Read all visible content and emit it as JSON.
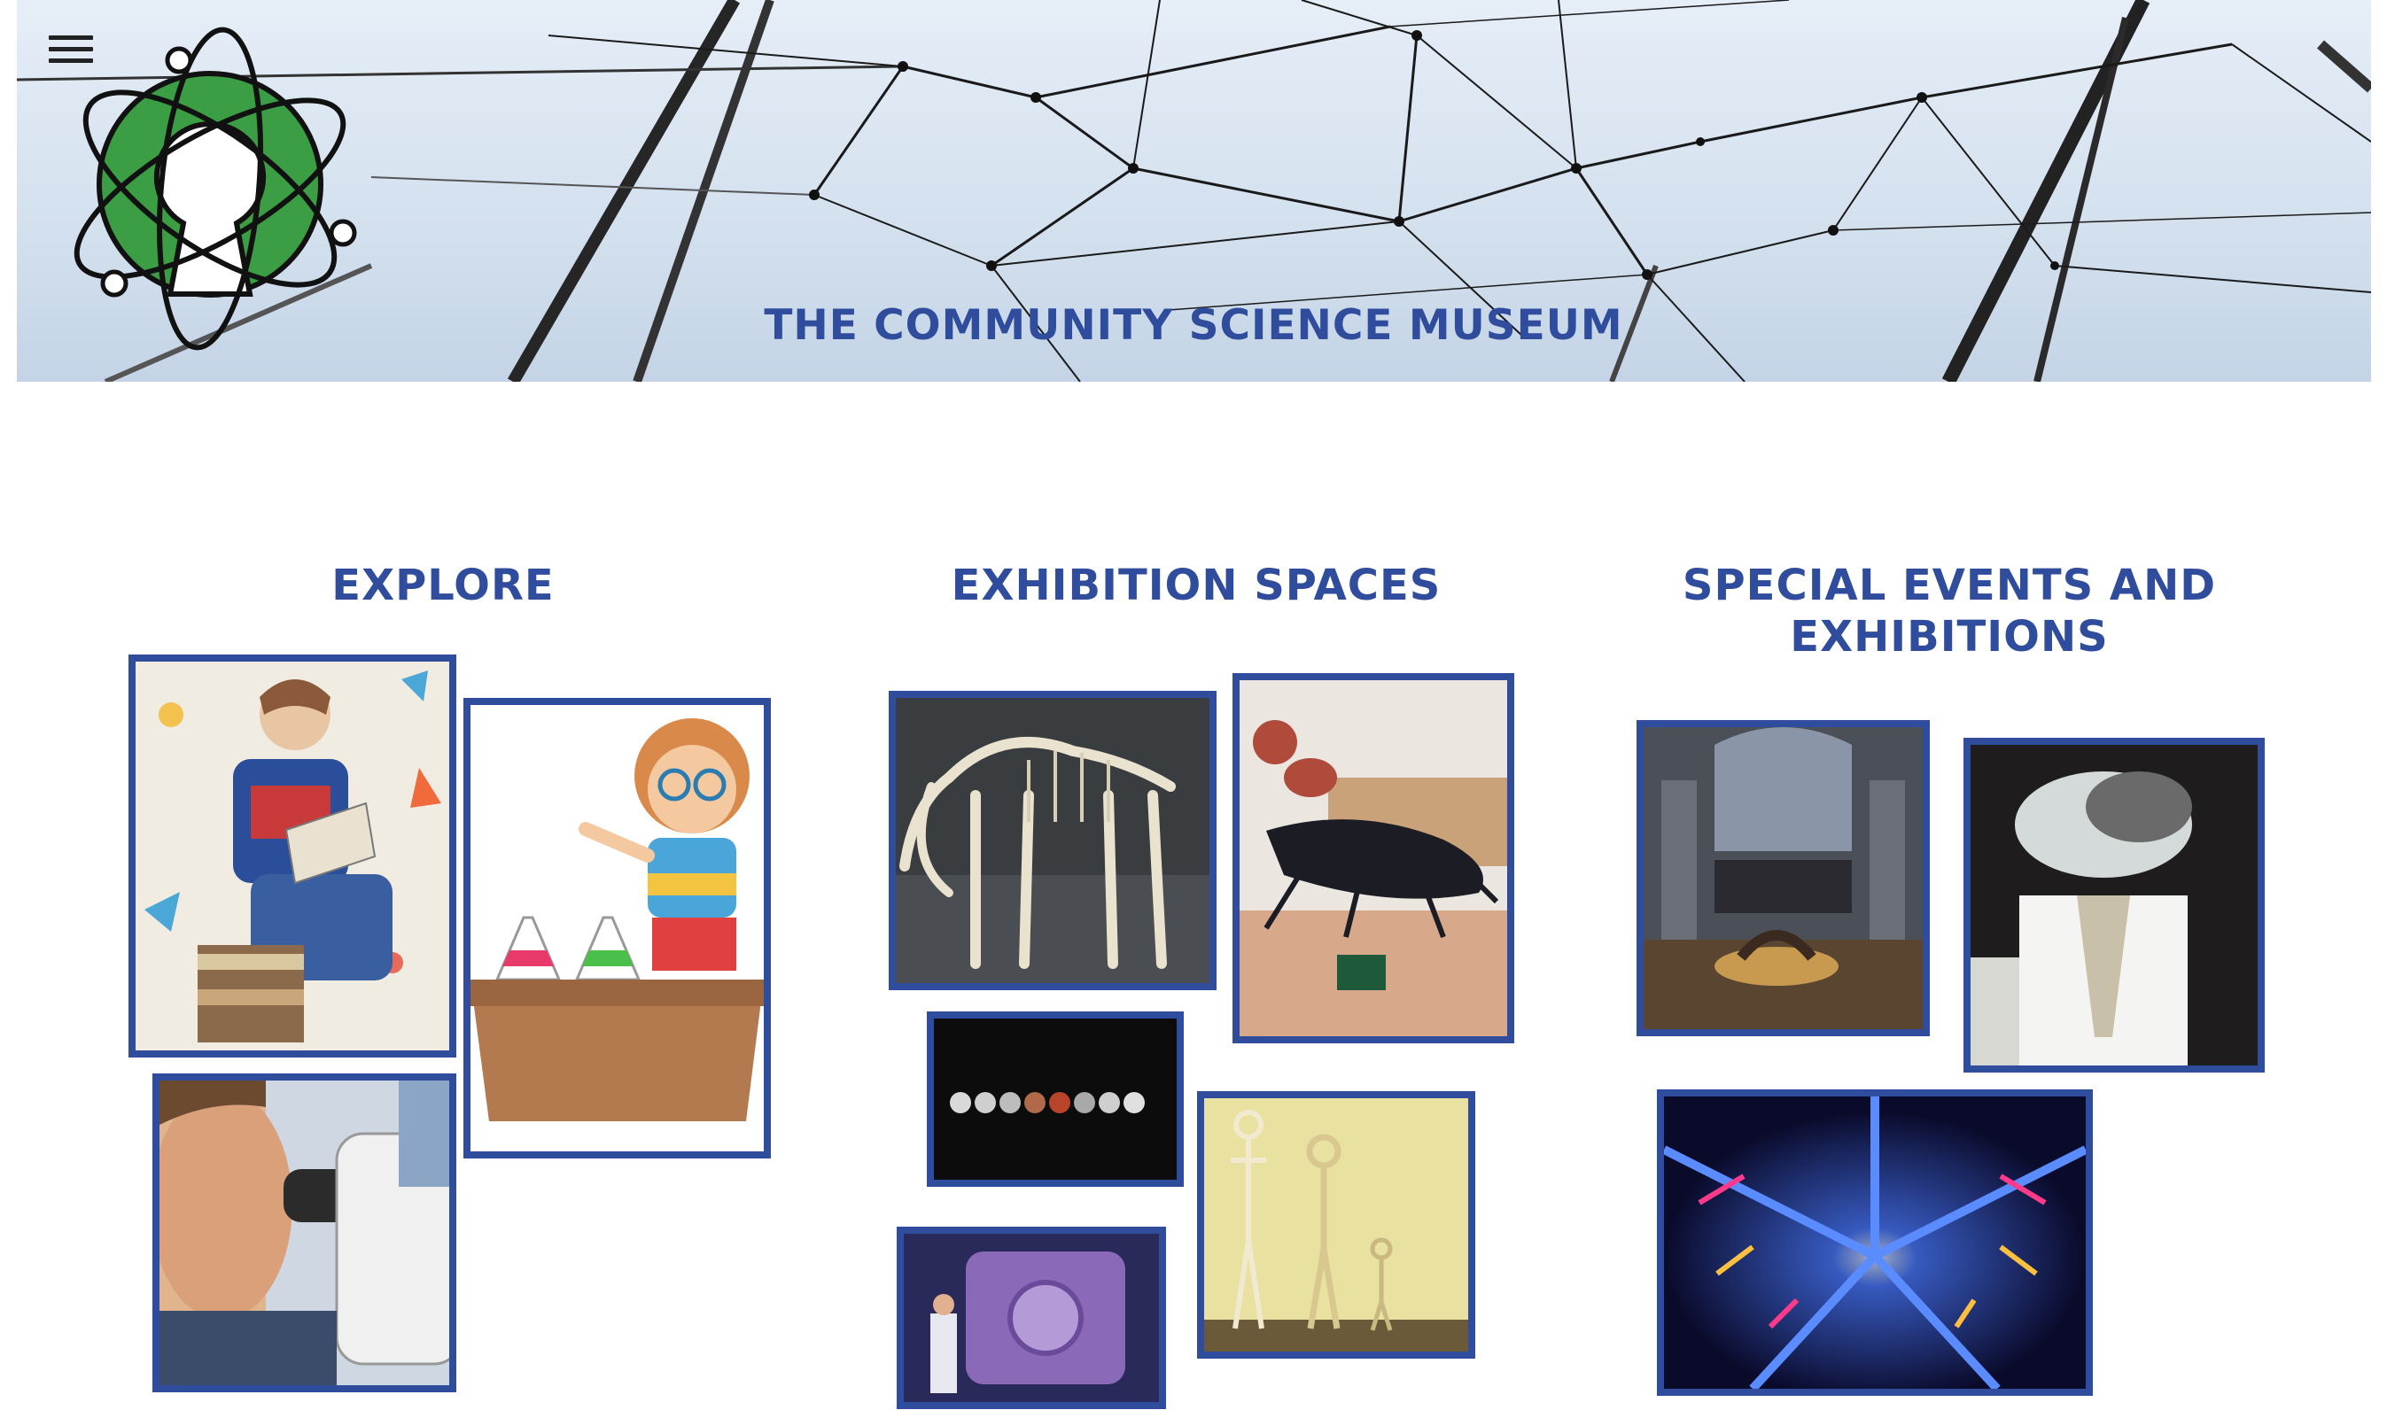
{
  "header": {
    "title": "THE COMMUNITY SCIENCE MUSEUM",
    "menu_icon": "hamburger-menu-icon",
    "logo_icon": "atom-keyhole-logo"
  },
  "sections": [
    {
      "title": "EXPLORE"
    },
    {
      "title": "EXHIBITION SPACES"
    },
    {
      "title": "SPECIAL EVENTS AND EXHIBITIONS"
    }
  ],
  "colors": {
    "accent": "#2f4d9c",
    "logo_green": "#3c9e44",
    "background": "#ffffff"
  }
}
